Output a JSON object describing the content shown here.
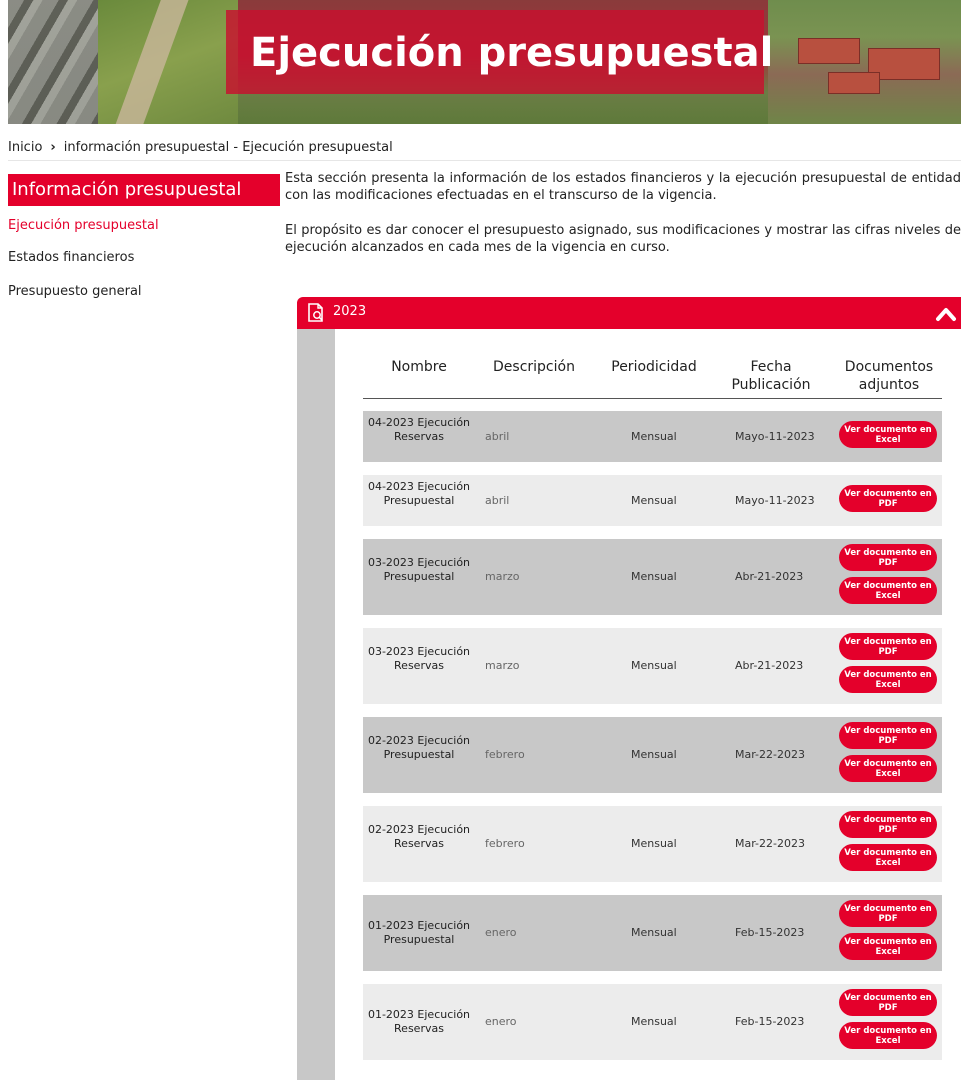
{
  "banner": {
    "title": "Ejecución presupuestal"
  },
  "breadcrumb": {
    "home": "Inicio",
    "current": "información presupuestal - Ejecución presupuestal"
  },
  "sidebar": {
    "header": "Información presupuestal",
    "items": [
      {
        "label": "Ejecución presupuestal",
        "active": true
      },
      {
        "label": "Estados financieros",
        "active": false
      },
      {
        "label": "Presupuesto general",
        "active": false
      }
    ]
  },
  "intro": {
    "p1": "Esta sección presenta la información de los estados financieros y la ejecución presupuestal de entidad con las modificaciones efectuadas en el transcurso de la vigencia.",
    "p2": "El propósito es dar conocer el presupuesto asignado, sus modificaciones y mostrar las cifras niveles de ejecución alcanzados en cada mes de la vigencia en curso."
  },
  "accordion": {
    "year": "2023"
  },
  "table": {
    "headers": {
      "nombre": "Nombre",
      "descripcion": "Descripción",
      "periodicidad": "Periodicidad",
      "fecha": "Fecha Publicación",
      "documentos": "Documentos adjuntos"
    },
    "rows": [
      {
        "name": "04-2023 Ejecución Reservas",
        "desc": "abril",
        "per": "Mensual",
        "fecha": "Mayo-11-2023",
        "buttons": [
          "Ver documento en Excel"
        ]
      },
      {
        "name": "04-2023 Ejecución Presupuestal",
        "desc": "abril",
        "per": "Mensual",
        "fecha": "Mayo-11-2023",
        "buttons": [
          "Ver documento en PDF"
        ]
      },
      {
        "name": "03-2023 Ejecución Presupuestal",
        "desc": "marzo",
        "per": "Mensual",
        "fecha": "Abr-21-2023",
        "buttons": [
          "Ver documento en PDF",
          "Ver documento en Excel"
        ]
      },
      {
        "name": "03-2023 Ejecución Reservas",
        "desc": "marzo",
        "per": "Mensual",
        "fecha": "Abr-21-2023",
        "buttons": [
          "Ver documento en PDF",
          "Ver documento en Excel"
        ]
      },
      {
        "name": "02-2023 Ejecución Presupuestal",
        "desc": "febrero",
        "per": "Mensual",
        "fecha": "Mar-22-2023",
        "buttons": [
          "Ver documento en PDF",
          "Ver documento en Excel"
        ]
      },
      {
        "name": "02-2023 Ejecución Reservas",
        "desc": "febrero",
        "per": "Mensual",
        "fecha": "Mar-22-2023",
        "buttons": [
          "Ver documento en PDF",
          "Ver documento en Excel"
        ]
      },
      {
        "name": "01-2023 Ejecución Presupuestal",
        "desc": "enero",
        "per": "Mensual",
        "fecha": "Feb-15-2023",
        "buttons": [
          "Ver documento en PDF",
          "Ver documento en Excel"
        ]
      },
      {
        "name": "01-2023 Ejecución Reservas",
        "desc": "enero",
        "per": "Mensual",
        "fecha": "Feb-15-2023",
        "buttons": [
          "Ver documento en PDF",
          "Ver documento en Excel"
        ]
      }
    ]
  },
  "colors": {
    "accent": "#e4002b",
    "row_dark": "#c8c8c8",
    "row_light": "#ececec"
  }
}
